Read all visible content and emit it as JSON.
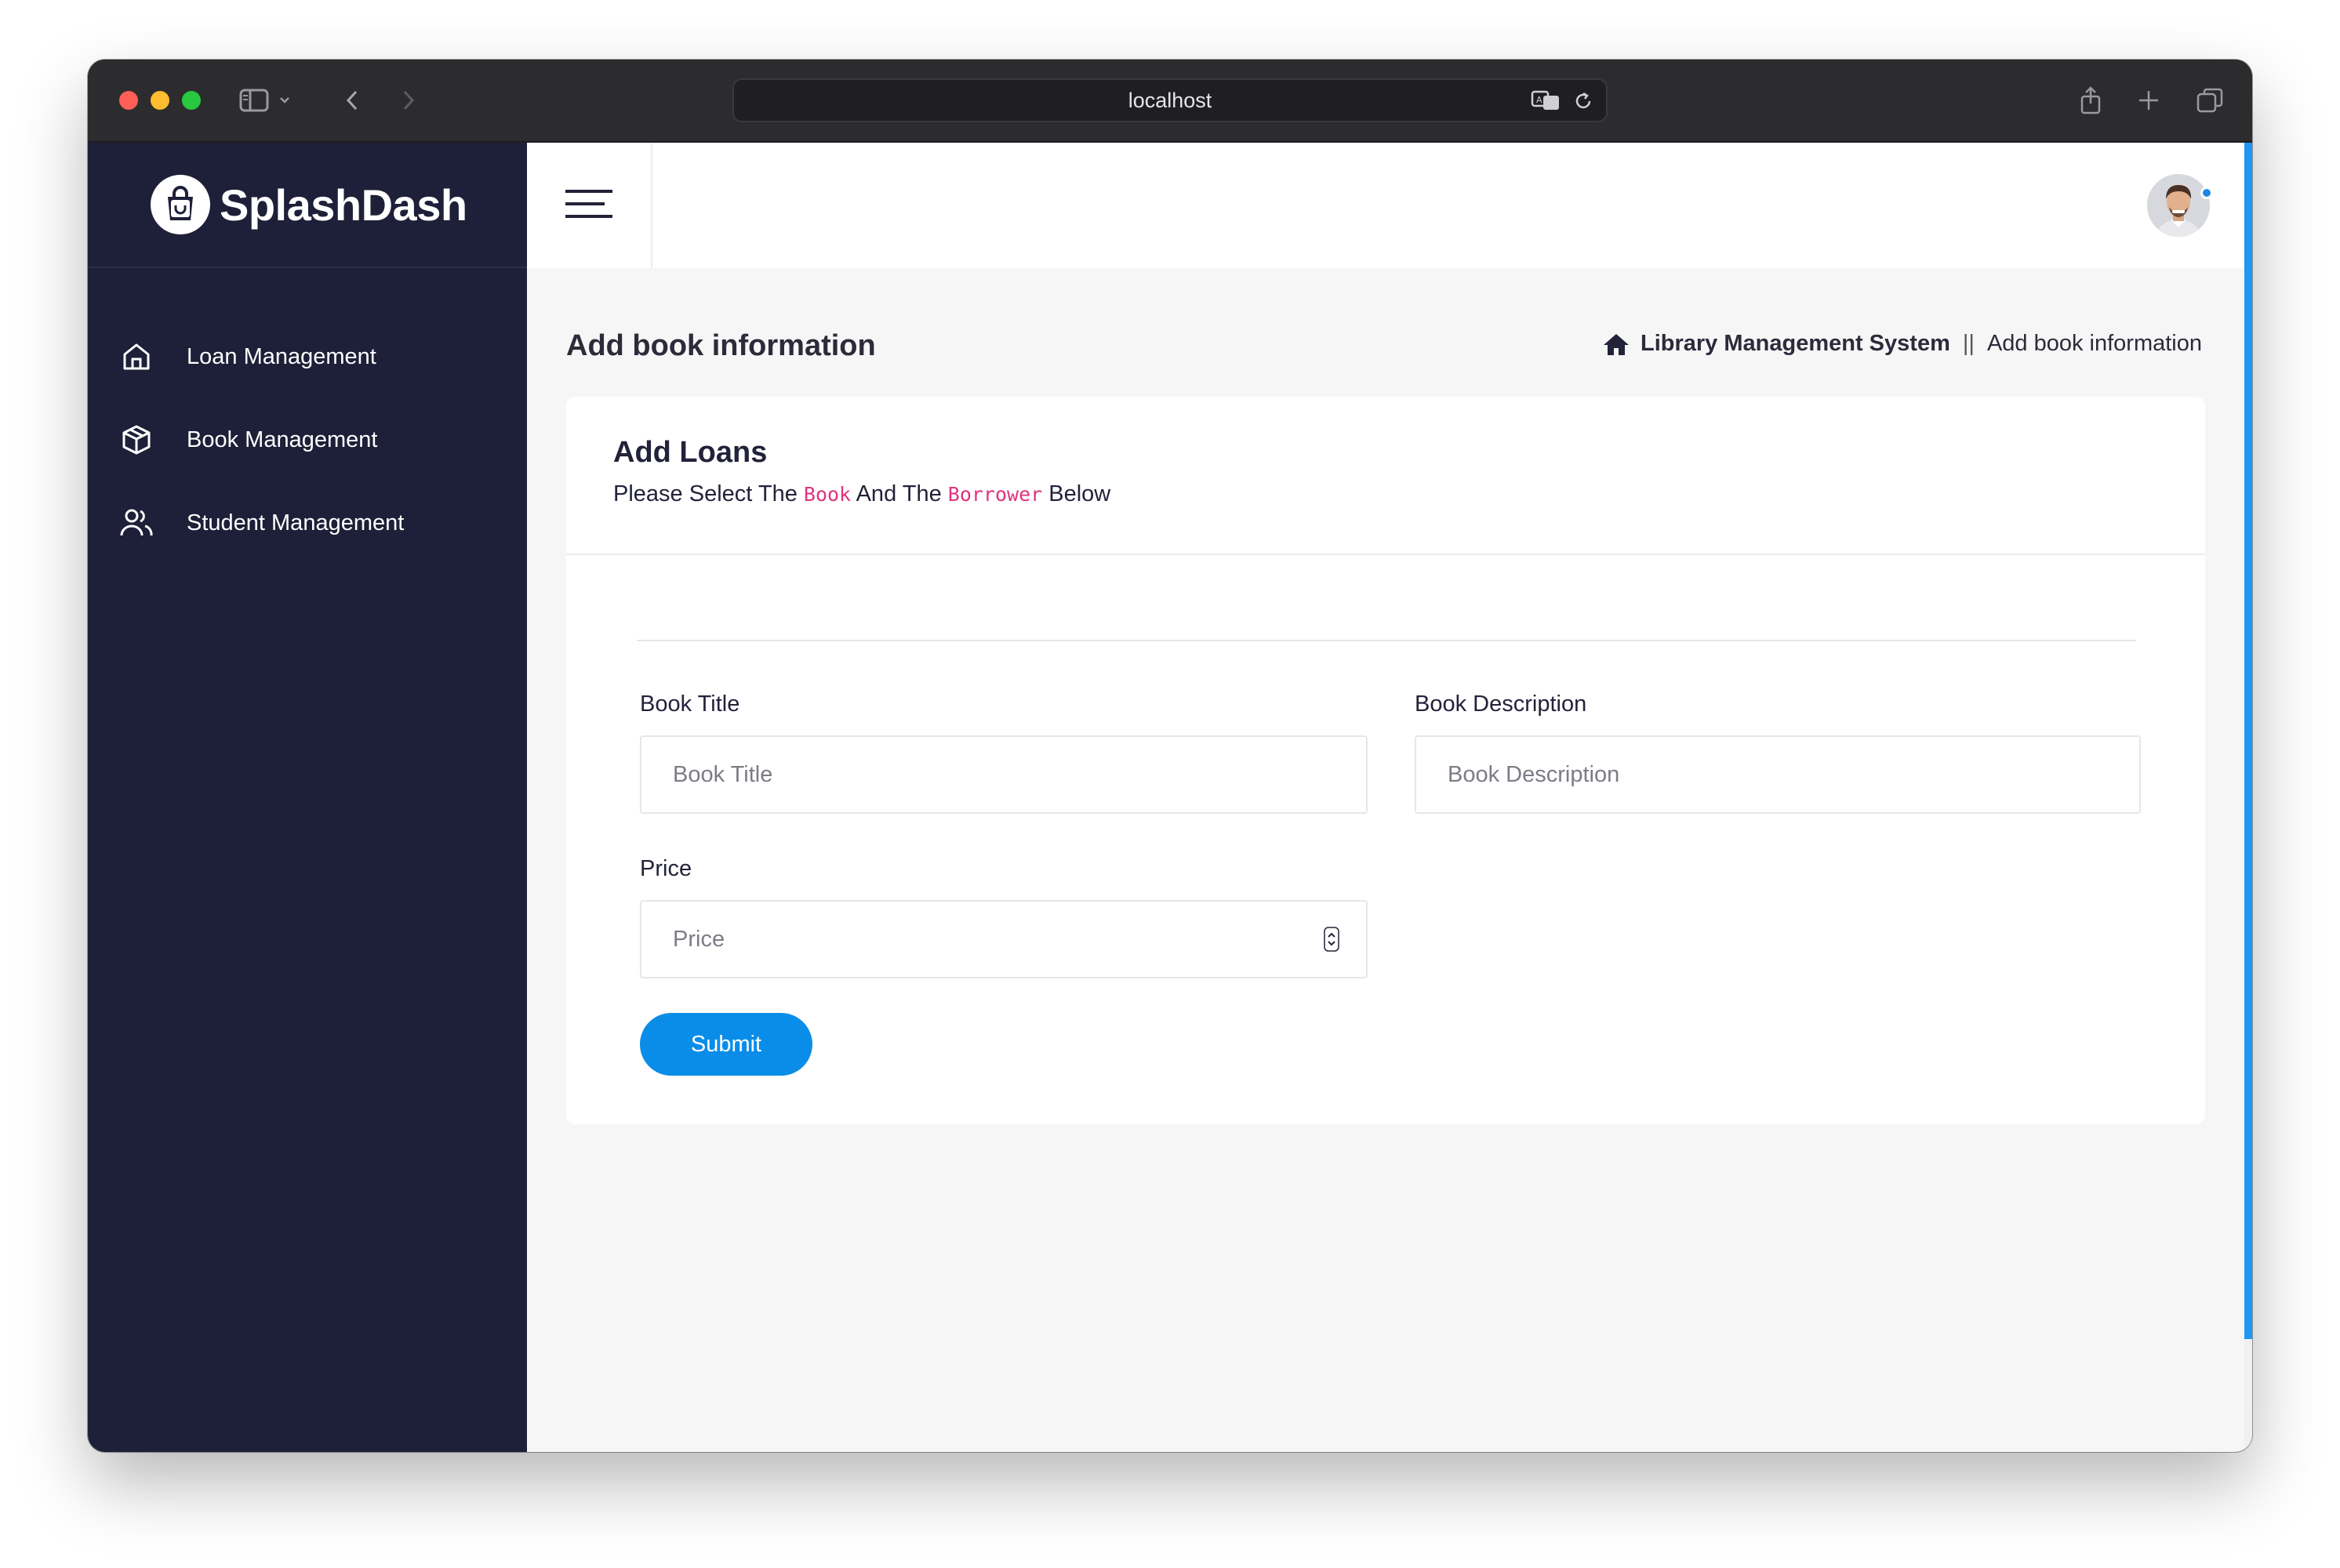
{
  "browser": {
    "url": "localhost"
  },
  "brand": {
    "name": "SplashDash"
  },
  "sidebar": {
    "items": [
      {
        "label": "Loan Management",
        "icon": "home-icon"
      },
      {
        "label": "Book Management",
        "icon": "package-icon"
      },
      {
        "label": "Student Management",
        "icon": "users-icon"
      }
    ]
  },
  "page": {
    "title": "Add book information",
    "breadcrumb": {
      "root": "Library Management System",
      "separator": "||",
      "current": "Add book information"
    }
  },
  "card": {
    "title": "Add Loans",
    "subtitle_prefix": "Please Select The",
    "subtitle_code1": "Book",
    "subtitle_mid": "And The",
    "subtitle_code2": "Borrower",
    "subtitle_suffix": "Below"
  },
  "form": {
    "book_title": {
      "label": "Book Title",
      "placeholder": "Book Title",
      "value": ""
    },
    "book_description": {
      "label": "Book Description",
      "placeholder": "Book Description",
      "value": ""
    },
    "price": {
      "label": "Price",
      "placeholder": "Price",
      "value": ""
    },
    "submit_label": "Submit"
  },
  "colors": {
    "sidebar_bg": "#1e1f38",
    "accent": "#0a8de8",
    "code_text": "#e0337e",
    "page_bg": "#f6f6f7"
  }
}
